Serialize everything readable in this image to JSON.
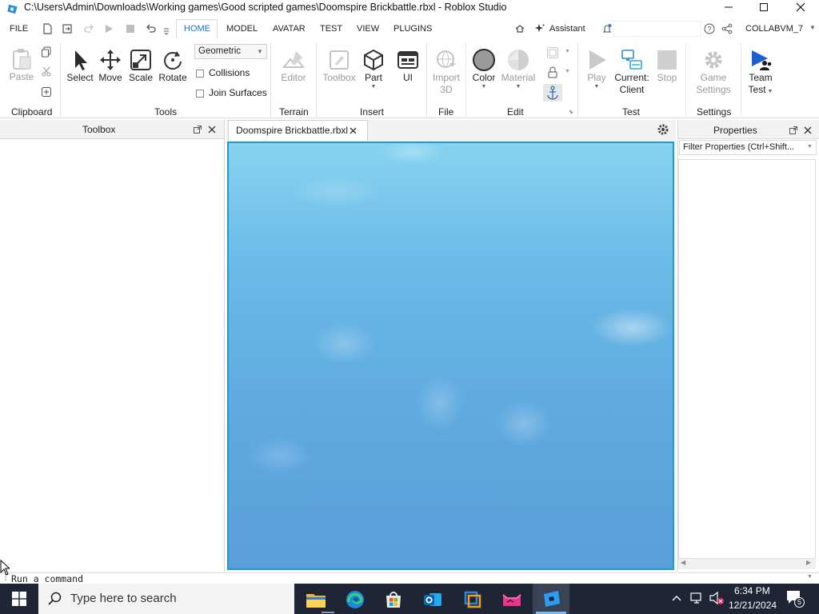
{
  "window": {
    "title": "C:\\Users\\Admin\\Downloads\\Working games\\Good scripted games\\Doomspire Brickbattle.rbxl - Roblox Studio"
  },
  "menubar": {
    "file_label": "FILE",
    "tabs": [
      {
        "label": "HOME",
        "active": true
      },
      {
        "label": "MODEL"
      },
      {
        "label": "AVATAR"
      },
      {
        "label": "TEST"
      },
      {
        "label": "VIEW"
      },
      {
        "label": "PLUGINS"
      }
    ],
    "assistant_label": "Assistant",
    "user_label": "COLLABVM_7"
  },
  "ribbon": {
    "clipboard": {
      "paste": "Paste",
      "group": "Clipboard"
    },
    "tools": {
      "select": "Select",
      "move": "Move",
      "scale": "Scale",
      "rotate": "Rotate",
      "mode_value": "Geometric",
      "collisions": "Collisions",
      "join_surfaces": "Join Surfaces",
      "group": "Tools"
    },
    "terrain": {
      "editor": "Editor",
      "group": "Terrain"
    },
    "insert": {
      "toolbox": "Toolbox",
      "part": "Part",
      "ui": "UI",
      "group": "Insert"
    },
    "file": {
      "import_line1": "Import",
      "import_line2": "3D",
      "group": "File"
    },
    "edit": {
      "color": "Color",
      "material": "Material",
      "group": "Edit"
    },
    "test": {
      "play": "Play",
      "current_line1": "Current:",
      "current_line2": "Client",
      "stop": "Stop",
      "group": "Test"
    },
    "settings": {
      "game_line1": "Game",
      "game_line2": "Settings",
      "group": "Settings"
    },
    "team": {
      "line1": "Team",
      "line2": "Test"
    }
  },
  "panels": {
    "toolbox_title": "Toolbox",
    "document_tab": "Doomspire Brickbattle.rbxl",
    "properties_title": "Properties",
    "filter_placeholder": "Filter Properties (Ctrl+Shift..."
  },
  "command_bar": {
    "placeholder": "Run a command"
  },
  "taskbar": {
    "search_placeholder": "Type here to search",
    "time": "6:34 PM",
    "date": "12/21/2024",
    "notification_count": "5",
    "apps": [
      "file-explorer-icon",
      "edge-icon",
      "store-icon",
      "outlook-icon",
      "virtualbox-icon",
      "cat-app-icon",
      "roblox-studio-icon"
    ]
  },
  "colors": {
    "accent_blue": "#1b9bd1",
    "taskbar": "#1f2535",
    "sky_top": "#86d3f0",
    "sky_bottom": "#5a9fda"
  }
}
